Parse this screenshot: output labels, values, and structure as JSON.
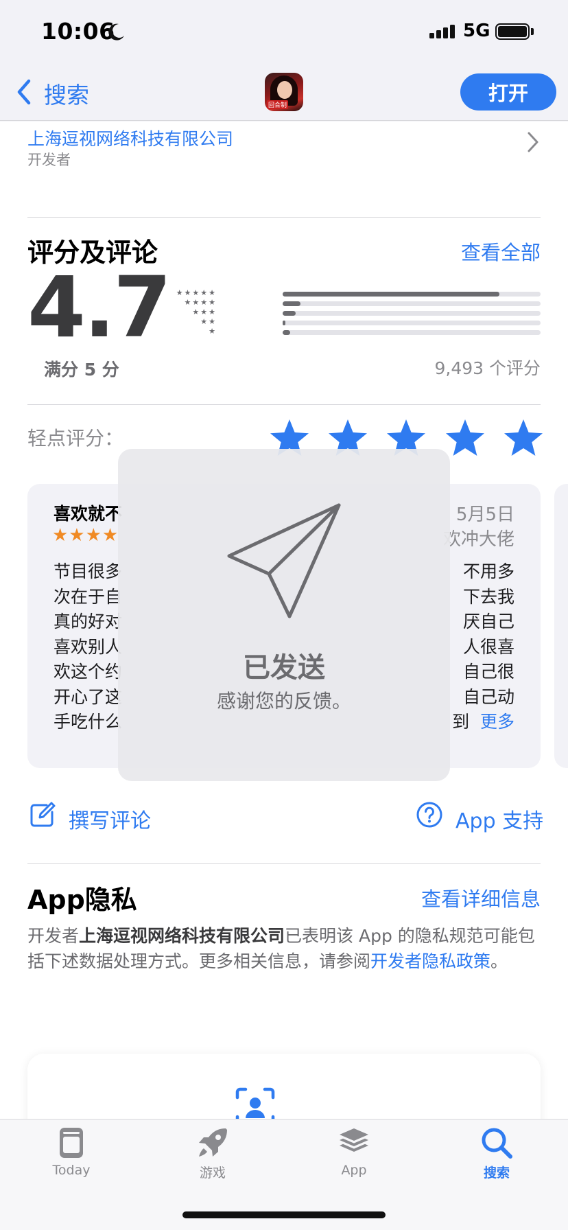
{
  "status_bar": {
    "time": "10:06",
    "network": "5G"
  },
  "nav": {
    "back_label": "搜索",
    "open_button": "打开",
    "app_icon_text": "回合制"
  },
  "developer": {
    "name": "上海逗视网络科技有限公司",
    "role": "开发者"
  },
  "ratings": {
    "section_title": "评分及评论",
    "see_all": "查看全部",
    "average": "4.7",
    "out_of": "满分 5 分",
    "count": "9,493 个评分",
    "distribution": [
      {
        "stars": "★★★★★",
        "fraction": 0.84
      },
      {
        "stars": "★★★★",
        "fraction": 0.07
      },
      {
        "stars": "★★★",
        "fraction": 0.05
      },
      {
        "stars": "★★",
        "fraction": 0.01
      },
      {
        "stars": "★",
        "fraction": 0.03
      }
    ]
  },
  "tap_to_rate": {
    "label": "轻点评分：",
    "star_count": 5,
    "selected": 5
  },
  "review": {
    "title": "喜欢就不",
    "stars": "★★★★",
    "date": "5月5日",
    "author": "欢冲大佬",
    "lines": [
      {
        "left": "节目很多",
        "right": "不用多"
      },
      {
        "left": "次在于自",
        "right": "下去我"
      },
      {
        "left": "真的好对",
        "right": "厌自己"
      },
      {
        "left": "喜欢别人",
        "right": "人很喜"
      },
      {
        "left": "欢这个约",
        "right": "自己很"
      },
      {
        "left": "开心了这",
        "right": "自己动"
      },
      {
        "left": "手吃什么",
        "right": "到"
      }
    ],
    "more": "更多"
  },
  "actions": {
    "write_review": "撰写评论",
    "app_support": "App 支持"
  },
  "privacy": {
    "title": "App隐私",
    "details_link": "查看详细信息",
    "text_prefix": "开发者",
    "developer": "上海逗视网络科技有限公司",
    "text_mid": "已表明该 App 的隐私规范可能包括下述数据处理方式。更多相关信息，请参阅",
    "policy_link": "开发者隐私政策",
    "text_suffix": "。"
  },
  "toast": {
    "title": "已发送",
    "subtitle": "感谢您的反馈。"
  },
  "tabs": [
    {
      "label": "Today",
      "icon": "today-icon",
      "active": false
    },
    {
      "label": "游戏",
      "icon": "rocket-icon",
      "active": false
    },
    {
      "label": "App",
      "icon": "layers-icon",
      "active": false
    },
    {
      "label": "搜索",
      "icon": "search-icon",
      "active": true
    }
  ],
  "colors": {
    "accent": "#2f7bf0",
    "review_star": "#f08a24",
    "background": "#f2f2f7"
  }
}
